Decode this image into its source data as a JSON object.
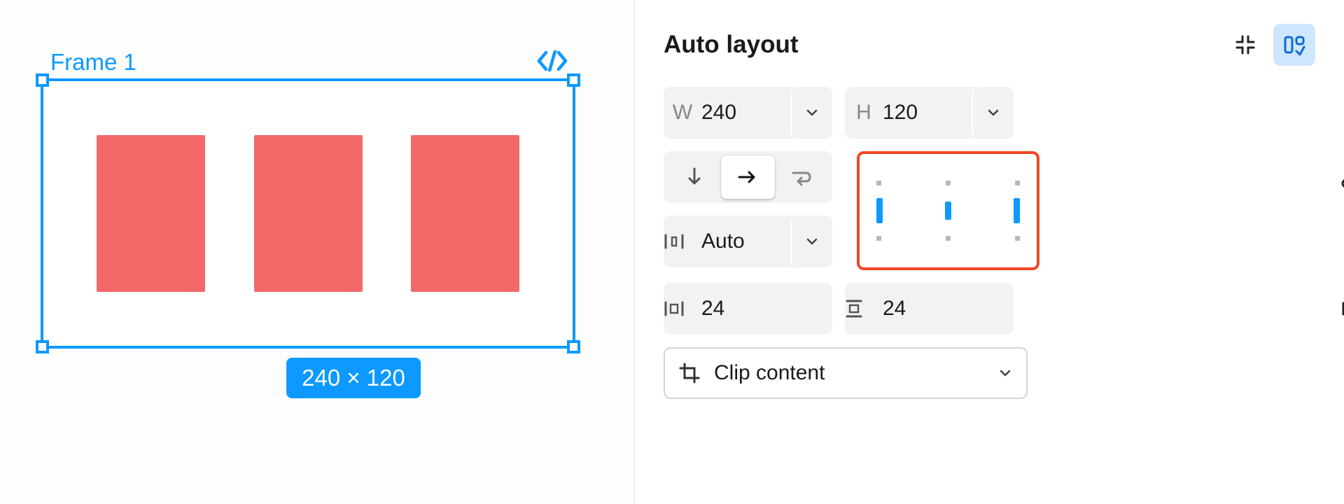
{
  "canvas": {
    "frame_label": "Frame 1",
    "dimensions_badge": "240 × 120"
  },
  "panel": {
    "title": "Auto layout",
    "width": {
      "prefix": "W",
      "value": "240"
    },
    "height": {
      "prefix": "H",
      "value": "120"
    },
    "gap": {
      "value": "Auto"
    },
    "h_padding": {
      "value": "24"
    },
    "v_padding": {
      "value": "24"
    },
    "clip_label": "Clip content"
  }
}
